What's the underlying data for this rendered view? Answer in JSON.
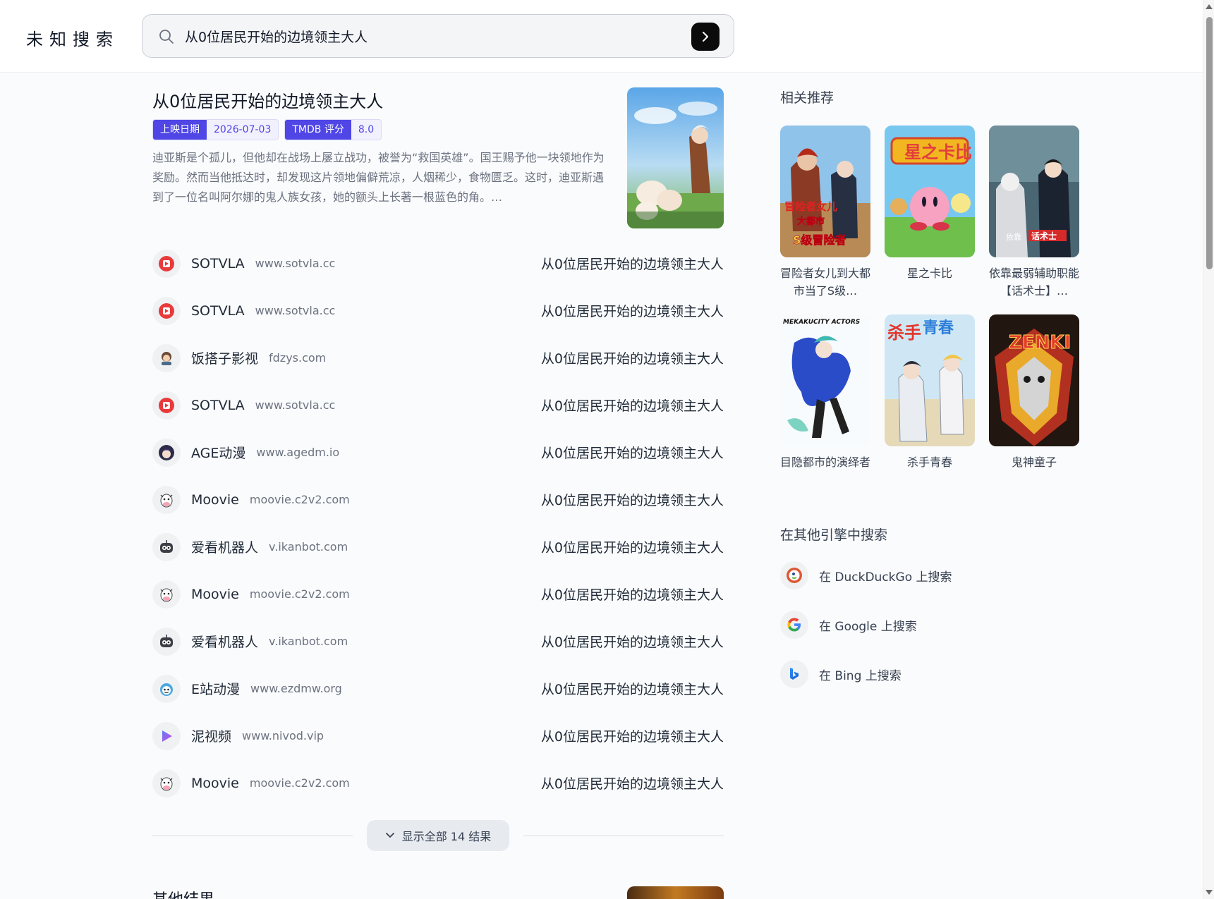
{
  "header": {
    "logo": "未知搜索",
    "search_value": "从0位居民开始的边境领主大人"
  },
  "featured": {
    "title": "从0位居民开始的边境领主大人",
    "badges": [
      {
        "key": "上映日期",
        "value": "2026-07-03"
      },
      {
        "key": "TMDB 评分",
        "value": "8.0"
      }
    ],
    "description": "迪亚斯是个孤儿，但他却在战场上屡立战功，被誉为“救国英雄”。国王赐予他一块领地作为奖励。然而当他抵达时，却发现这片领地偏僻荒凉，人烟稀少，食物匮乏。这时，迪亚斯遇到了一位名叫阿尔娜的鬼人族女孩，她的额头上长著一根蓝色的角。…"
  },
  "results": [
    {
      "name": "SOTVLA",
      "domain": "www.sotvla.cc",
      "title": "从0位居民开始的边境领主大人",
      "icon": "sotvla-icon"
    },
    {
      "name": "SOTVLA",
      "domain": "www.sotvla.cc",
      "title": "从0位居民开始的边境领主大人",
      "icon": "sotvla-icon"
    },
    {
      "name": "饭搭子影视",
      "domain": "fdzys.com",
      "title": "从0位居民开始的边境领主大人",
      "icon": "fdzys-icon"
    },
    {
      "name": "SOTVLA",
      "domain": "www.sotvla.cc",
      "title": "从0位居民开始的边境领主大人",
      "icon": "sotvla-icon"
    },
    {
      "name": "AGE动漫",
      "domain": "www.agedm.io",
      "title": "从0位居民开始的边境领主大人",
      "icon": "agedm-icon"
    },
    {
      "name": "Moovie",
      "domain": "moovie.c2v2.com",
      "title": "从0位居民开始的边境领主大人",
      "icon": "moovie-icon"
    },
    {
      "name": "爱看机器人",
      "domain": "v.ikanbot.com",
      "title": "从0位居民开始的边境领主大人",
      "icon": "ikanbot-icon"
    },
    {
      "name": "Moovie",
      "domain": "moovie.c2v2.com",
      "title": "从0位居民开始的边境领主大人",
      "icon": "moovie-icon"
    },
    {
      "name": "爱看机器人",
      "domain": "v.ikanbot.com",
      "title": "从0位居民开始的边境领主大人",
      "icon": "ikanbot-icon"
    },
    {
      "name": "E站动漫",
      "domain": "www.ezdmw.org",
      "title": "从0位居民开始的边境领主大人",
      "icon": "ezdmw-icon"
    },
    {
      "name": "泥视频",
      "domain": "www.nivod.vip",
      "title": "从0位居民开始的边境领主大人",
      "icon": "nivod-icon"
    },
    {
      "name": "Moovie",
      "domain": "moovie.c2v2.com",
      "title": "从0位居民开始的边境领主大人",
      "icon": "moovie-icon"
    }
  ],
  "show_all_label": "显示全部 14 结果",
  "other_results_title": "其他结果",
  "sidebar": {
    "related_title": "相关推荐",
    "recommendations": [
      {
        "title": "冒险者女儿到大都市当了S级…",
        "poster_text": "冒险者女儿 大都市 S级冒险者"
      },
      {
        "title": "星之卡比",
        "poster_text": "星之卡比"
      },
      {
        "title": "依靠最弱辅助职能【话术士】…",
        "poster_text": "依靠 话术士"
      },
      {
        "title": "目隐都市的演绎者",
        "poster_text": "MEKAKUCITY ACTORS"
      },
      {
        "title": "杀手青春",
        "poster_text": "杀手青春"
      },
      {
        "title": "鬼神童子",
        "poster_text": "ZENKI"
      }
    ],
    "engines_title": "在其他引擎中搜索",
    "engines": [
      {
        "label": "在 DuckDuckGo 上搜索",
        "icon": "duckduckgo-icon"
      },
      {
        "label": "在 Google 上搜索",
        "icon": "google-icon"
      },
      {
        "label": "在 Bing 上搜索",
        "icon": "bing-icon"
      }
    ]
  }
}
